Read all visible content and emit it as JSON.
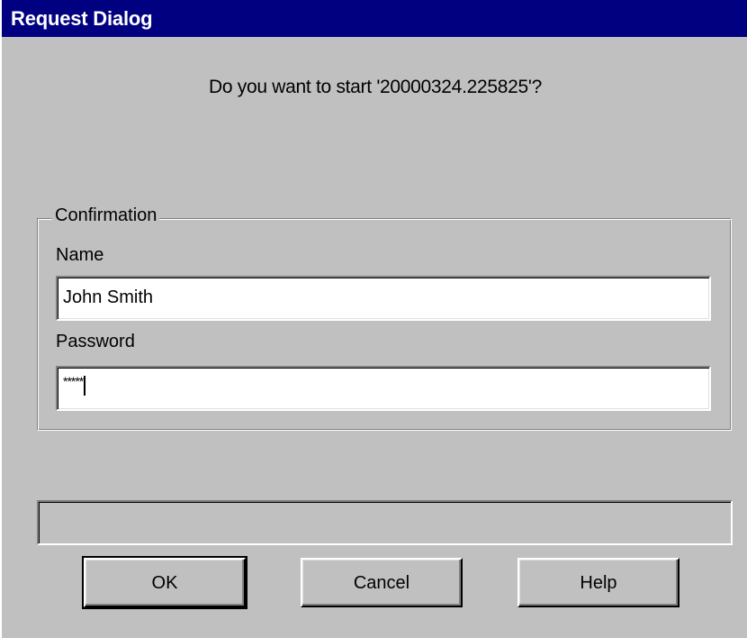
{
  "window": {
    "title": "Request Dialog"
  },
  "message": "Do you want to start '20000324.225825'?",
  "confirmation": {
    "group_label": "Confirmation",
    "name_label": "Name",
    "name_value": "John Smith",
    "password_label": "Password",
    "password_mask": "*****"
  },
  "status_text": "",
  "buttons": {
    "ok": "OK",
    "cancel": "Cancel",
    "help": "Help"
  },
  "colors": {
    "titlebar": "#000080",
    "face": "#c0c0c0"
  }
}
